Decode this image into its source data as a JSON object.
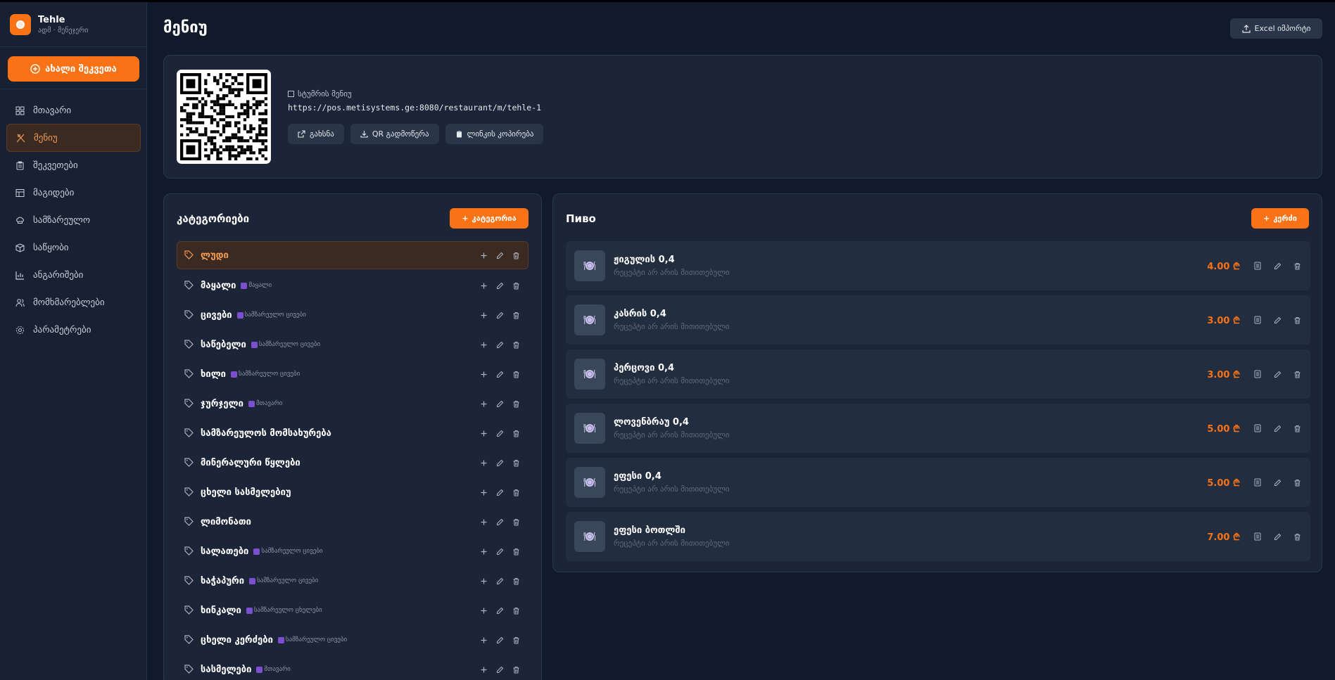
{
  "brand": {
    "name": "Tehle",
    "subtitle": "ადმ · მენეჯერი"
  },
  "sidebar": {
    "new_order_label": "ახალი შეკვეთა",
    "items": [
      {
        "label": "მთავარი",
        "icon": "dashboard-icon",
        "active": false
      },
      {
        "label": "მენიუ",
        "icon": "utensils-icon",
        "active": true
      },
      {
        "label": "შეკვეთები",
        "icon": "clipboard-icon",
        "active": false
      },
      {
        "label": "მაგიდები",
        "icon": "table-icon",
        "active": false
      },
      {
        "label": "სამზარეულო",
        "icon": "chef-hat-icon",
        "active": false
      },
      {
        "label": "საწყობი",
        "icon": "package-icon",
        "active": false
      },
      {
        "label": "ანგარიშები",
        "icon": "bar-chart-icon",
        "active": false
      },
      {
        "label": "მომხმარებლები",
        "icon": "users-icon",
        "active": false
      },
      {
        "label": "პარამეტრები",
        "icon": "gear-icon",
        "active": false
      }
    ]
  },
  "header": {
    "title": "მენიუ",
    "excel_label": "Excel იმპორტი"
  },
  "qr": {
    "label": "სტუმრის მენიუ",
    "url": "https://pos.metisystems.ge:8080/restaurant/m/tehle-1",
    "open_label": "გახსნა",
    "download_label": "QR გადმოწერა",
    "copy_label": "ლინკის კოპირება"
  },
  "categories": {
    "title": "კატეგორიები",
    "add_label": "კატეგორია",
    "list": [
      {
        "name": "ლუდი",
        "badge": "",
        "active": true
      },
      {
        "name": "მაყალი",
        "badge": "მაყალი",
        "active": false
      },
      {
        "name": "ცივები",
        "badge": "სამზარეულო ცივები",
        "active": false
      },
      {
        "name": "საწებელი",
        "badge": "სამზარეულო ცივები",
        "active": false
      },
      {
        "name": "ხილი",
        "badge": "სამზარეულო ცივები",
        "active": false
      },
      {
        "name": "ჯურჯელი",
        "badge": "მთავარი",
        "active": false
      },
      {
        "name": "სამზარეულოს მომსახურება",
        "badge": "",
        "active": false
      },
      {
        "name": "მინერალური წყლები",
        "badge": "",
        "active": false
      },
      {
        "name": "ცხელი სასმელებიუ",
        "badge": "",
        "active": false
      },
      {
        "name": "ლიმონათი",
        "badge": "",
        "active": false
      },
      {
        "name": "სალათები",
        "badge": "სამზარეულო ცივები",
        "active": false
      },
      {
        "name": "ხაჭაპური",
        "badge": "სამზარეულო ცივები",
        "active": false
      },
      {
        "name": "ხინკალი",
        "badge": "სამზარეულო ცხელები",
        "active": false
      },
      {
        "name": "ცხელი კერძები",
        "badge": "სამზარეულო ცივები",
        "active": false
      },
      {
        "name": "სასმელები",
        "badge": "მთავარი",
        "active": false
      }
    ]
  },
  "items": {
    "title": "Пиво",
    "add_label": "კერძი",
    "list": [
      {
        "name": "ჟიგულის 0,4",
        "note": "რეცეპტი არ არის მითითებული",
        "price": "4.00 ₾"
      },
      {
        "name": "კასრის 0,4",
        "note": "რეცეპტი არ არის მითითებული",
        "price": "3.00 ₾"
      },
      {
        "name": "პერცოვი 0,4",
        "note": "რეცეპტი არ არის მითითებული",
        "price": "3.00 ₾"
      },
      {
        "name": "ლოვენბრაუ 0,4",
        "note": "რეცეპტი არ არის მითითებული",
        "price": "5.00 ₾"
      },
      {
        "name": "ეფესი 0,4",
        "note": "რეცეპტი არ არის მითითებული",
        "price": "5.00 ₾"
      },
      {
        "name": "ეფესი ბოთლში",
        "note": "რეცეპტი არ არის მითითებული",
        "price": "7.00 ₾"
      }
    ]
  },
  "colors": {
    "accent": "#f97316",
    "background": "#111a2b",
    "card": "#1b2537"
  }
}
